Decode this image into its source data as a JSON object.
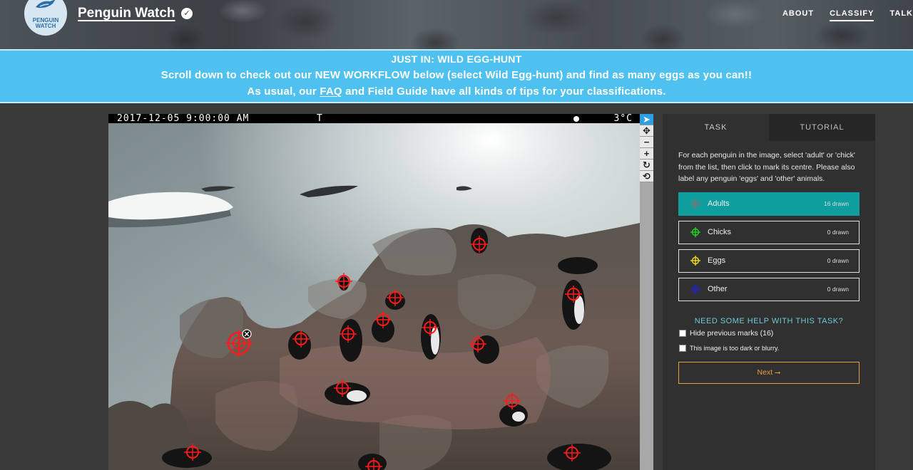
{
  "header": {
    "logo_text_line1": "PENGUIN",
    "logo_text_line2": "WATCH",
    "title": "Penguin Watch",
    "verified_glyph": "✓",
    "nav": [
      {
        "label": "ABOUT",
        "active": false
      },
      {
        "label": "CLASSIFY",
        "active": true
      },
      {
        "label": "TALK",
        "active": false
      }
    ]
  },
  "banner": {
    "heading": "JUST IN: WILD EGG-HUNT",
    "line2": "Scroll down to check out our NEW WORKFLOW below (select Wild Egg-hunt) and find as many eggs as you can!!",
    "line3_prefix": "As usual, our ",
    "line3_link": "FAQ",
    "line3_suffix": " and Field Guide have all kinds of tips for your classifications."
  },
  "subject": {
    "timestamp": "2017-12-05 9:00:00 AM",
    "camera_letter": "T",
    "temperature": "3°C",
    "mark_color": "#ff1a1a",
    "marks_count": 16
  },
  "toolbar": {
    "tools": [
      {
        "name": "pointer-tool",
        "glyph": "➤",
        "selected": true
      },
      {
        "name": "pan-tool",
        "glyph": "✥",
        "selected": false
      },
      {
        "name": "zoom-out-tool",
        "glyph": "−",
        "selected": false
      },
      {
        "name": "zoom-in-tool",
        "glyph": "+",
        "selected": false
      },
      {
        "name": "rotate-tool",
        "glyph": "↻",
        "selected": false
      },
      {
        "name": "reset-tool",
        "glyph": "⟲",
        "selected": false
      }
    ]
  },
  "panel": {
    "tabs": [
      {
        "label": "TASK",
        "active": true
      },
      {
        "label": "TUTORIAL",
        "active": false
      }
    ],
    "instructions": "For each penguin in the image, select 'adult' or 'chick' from the list, then click to mark its centre. Please also label any penguin 'eggs' and 'other' animals.",
    "choices": [
      {
        "label": "Adults",
        "count": "16 drawn",
        "color": "#777777",
        "active": true
      },
      {
        "label": "Chicks",
        "count": "0 drawn",
        "color": "#22cc22",
        "active": false
      },
      {
        "label": "Eggs",
        "count": "0 drawn",
        "color": "#e8d21c",
        "active": false
      },
      {
        "label": "Other",
        "count": "0 drawn",
        "color": "#2222bb",
        "active": false
      }
    ],
    "help_text": "NEED SOME HELP WITH THIS TASK?",
    "hide_marks_label": "Hide previous marks (16)",
    "too_dark_label": "This image is too dark or blurry.",
    "next_label": "Next ⭢"
  }
}
